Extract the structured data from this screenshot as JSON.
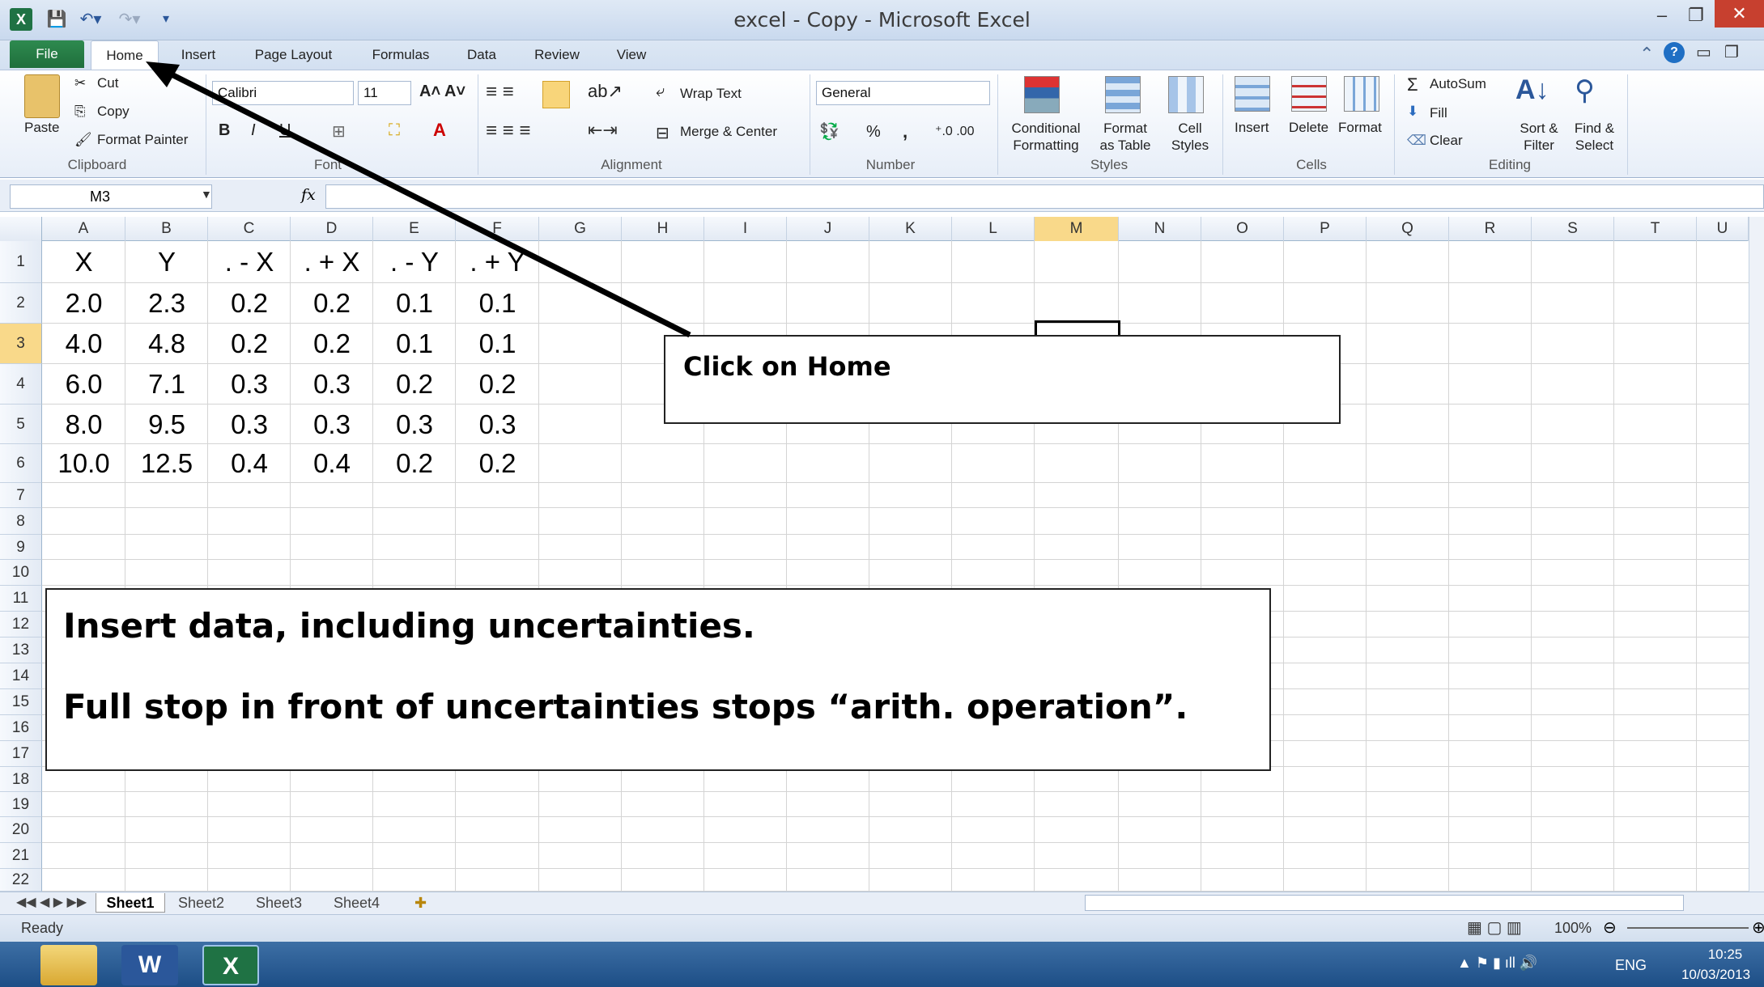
{
  "window": {
    "title": "excel - Copy - Microsoft Excel",
    "minimize": "–",
    "restore": "❐",
    "close": "✕"
  },
  "tabs": [
    "File",
    "Home",
    "Insert",
    "Page Layout",
    "Formulas",
    "Data",
    "Review",
    "View"
  ],
  "ribbon": {
    "clipboard": {
      "paste": "Paste",
      "cut": "Cut",
      "copy": "Copy",
      "format_painter": "Format Painter",
      "label": "Clipboard"
    },
    "font": {
      "name": "Calibri",
      "size": "11",
      "label": "Font"
    },
    "alignment": {
      "wrap_text": "Wrap Text",
      "merge_center": "Merge & Center",
      "label": "Alignment"
    },
    "number": {
      "format": "General",
      "percent": "%",
      "comma": ",",
      "label": "Number"
    },
    "styles": {
      "conditional_1": "Conditional",
      "conditional_2": "Formatting",
      "format_table_1": "Format",
      "format_table_2": "as Table",
      "cell_styles_1": "Cell",
      "cell_styles_2": "Styles",
      "label": "Styles"
    },
    "cells": {
      "insert": "Insert",
      "delete": "Delete",
      "format": "Format",
      "label": "Cells"
    },
    "editing": {
      "autosum": "AutoSum",
      "fill": "Fill",
      "clear": "Clear",
      "sort_1": "Sort &",
      "sort_2": "Filter",
      "find_1": "Find &",
      "find_2": "Select",
      "label": "Editing"
    }
  },
  "formula_bar": {
    "name_box": "M3",
    "fx": "fx",
    "value": ""
  },
  "columns": [
    "A",
    "B",
    "C",
    "D",
    "E",
    "F",
    "G",
    "H",
    "I",
    "J",
    "K",
    "L",
    "M",
    "N",
    "O",
    "P",
    "Q",
    "R",
    "S",
    "T",
    "U"
  ],
  "rows": [
    "1",
    "2",
    "3",
    "4",
    "5",
    "6",
    "7",
    "8",
    "9",
    "10",
    "11",
    "12",
    "13",
    "14",
    "15",
    "16",
    "17",
    "18",
    "19",
    "20",
    "21",
    "22"
  ],
  "table": {
    "headers": [
      "X",
      "Y",
      ". - X",
      ". + X",
      ". - Y",
      ". + Y"
    ],
    "data": [
      [
        "2.0",
        "2.3",
        "0.2",
        "0.2",
        "0.1",
        "0.1"
      ],
      [
        "4.0",
        "4.8",
        "0.2",
        "0.2",
        "0.1",
        "0.1"
      ],
      [
        "6.0",
        "7.1",
        "0.3",
        "0.3",
        "0.2",
        "0.2"
      ],
      [
        "8.0",
        "9.5",
        "0.3",
        "0.3",
        "0.3",
        "0.3"
      ],
      [
        "10.0",
        "12.5",
        "0.4",
        "0.4",
        "0.2",
        "0.2"
      ]
    ]
  },
  "callouts": {
    "home": "Click on Home",
    "insert_line1": "Insert data, including uncertainties.",
    "insert_line2": "Full stop in front of uncertainties stops “arith. operation”."
  },
  "sheets": [
    "Sheet1",
    "Sheet2",
    "Sheet3",
    "Sheet4"
  ],
  "status": {
    "ready": "Ready",
    "zoom": "100%"
  },
  "taskbar": {
    "lang": "ENG",
    "time": "10:25",
    "date": "10/03/2013"
  },
  "colors": {
    "accent_green": "#1f7244",
    "selected_col": "#f9d98a",
    "taskbar": "#1d4e86"
  }
}
